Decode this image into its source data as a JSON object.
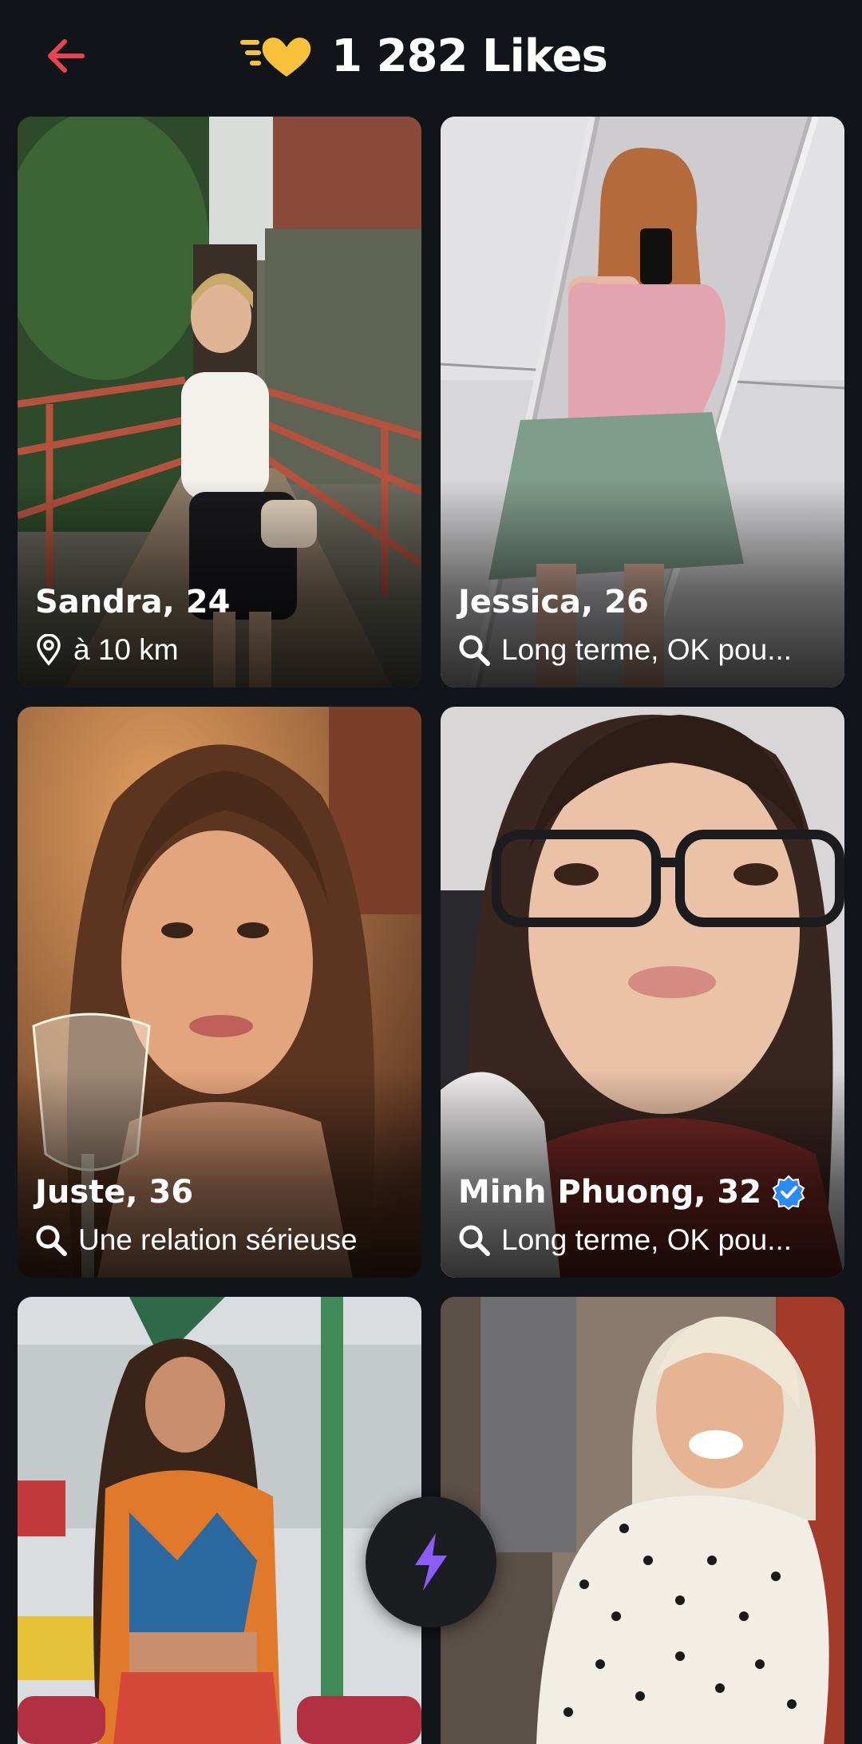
{
  "header": {
    "title": "1 282 Likes"
  },
  "colors": {
    "back_arrow": "#e8434f",
    "heart": "#f7c23a",
    "bolt": "#8b5cf6",
    "verified": "#2b8af7"
  },
  "icons": {
    "back": "back-arrow-icon",
    "header": "gold-heart-icon",
    "location": "location-pin-icon",
    "search": "search-icon",
    "verified": "verified-badge-icon",
    "boost": "lightning-bolt-icon"
  },
  "profiles": [
    {
      "name": "Sandra, 24",
      "detail": "à 10 km"
    },
    {
      "name": "Jessica, 26",
      "detail": "Long terme, OK pou..."
    },
    {
      "name": "Juste, 36",
      "detail": "Une relation sérieuse"
    },
    {
      "name": "Minh Phuong, 32",
      "detail": "Long terme, OK pou..."
    }
  ]
}
